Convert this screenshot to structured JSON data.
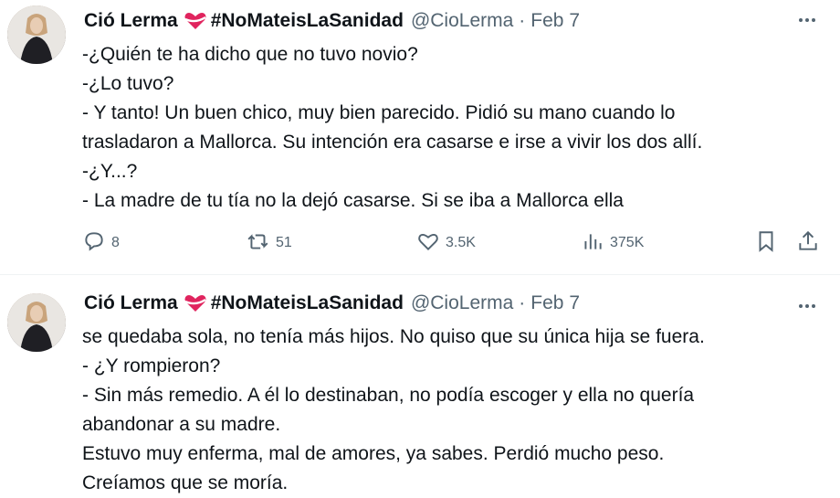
{
  "tweets": [
    {
      "author": {
        "name": "Ció Lerma",
        "hashtag": "#NoMateisLaSanidad",
        "handle": "@CioLerma",
        "separator": "·",
        "date": "Feb 7"
      },
      "lines": [
        "-¿Quién te ha dicho que no tuvo novio?",
        "-¿Lo tuvo?",
        "- Y tanto! Un buen chico, muy bien parecido. Pidió su mano cuando lo",
        "trasladaron a Mallorca. Su intención era casarse e irse a vivir los dos allí.",
        "-¿Y...?",
        "- La madre de tu tía no la dejó casarse. Si se iba a Mallorca ella"
      ],
      "actions": {
        "replies": "8",
        "retweets": "51",
        "likes": "3.5K",
        "views": "375K"
      }
    },
    {
      "author": {
        "name": "Ció Lerma",
        "hashtag": "#NoMateisLaSanidad",
        "handle": "@CioLerma",
        "separator": "·",
        "date": "Feb 7"
      },
      "lines": [
        "se quedaba sola, no tenía más hijos. No quiso que su única hija se fuera.",
        "- ¿Y rompieron?",
        "- Sin más remedio. A él lo destinaban, no podía escoger y ella no quería",
        "abandonar a su madre.",
        "Estuvo muy enferma, mal de amores, ya sabes. Perdió mucho peso.",
        "Creíamos que se moría."
      ]
    }
  ],
  "icons": {
    "heart_emoji": "heart-with-ribbon-icon",
    "more": "more-dots-icon",
    "reply": "reply-icon",
    "retweet": "retweet-icon",
    "like": "like-heart-icon",
    "views": "views-chart-icon",
    "bookmark": "bookmark-icon",
    "share": "share-icon"
  },
  "colors": {
    "text": "#0f1419",
    "secondary": "#536471",
    "divider": "#eff3f4",
    "emoji_red": "#e0245e"
  }
}
